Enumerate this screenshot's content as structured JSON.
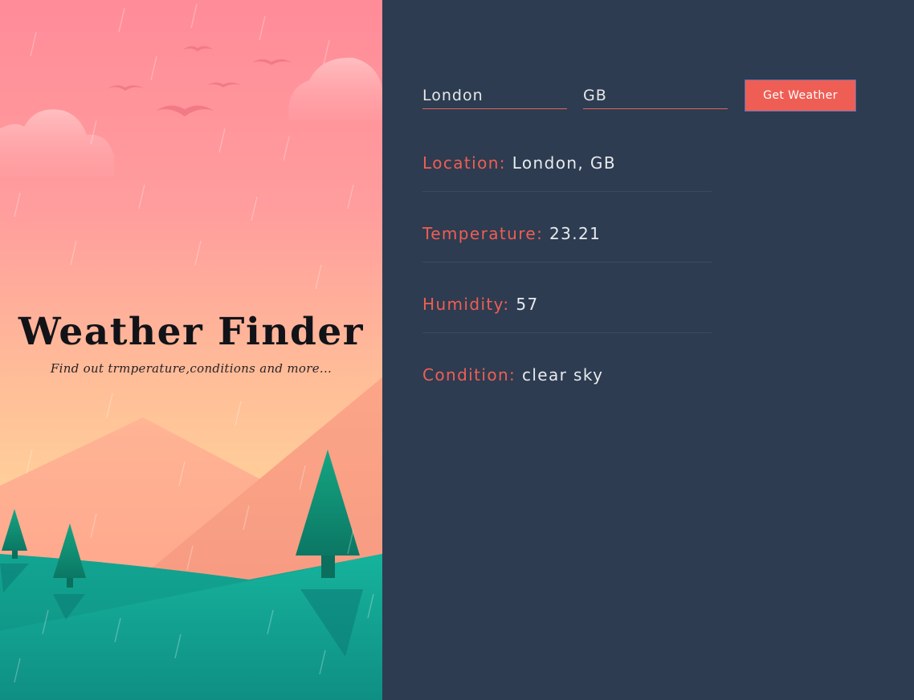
{
  "app": {
    "title": "Weather Finder",
    "subtitle": "Find out trmperature,conditions and more..."
  },
  "form": {
    "city_value": "London",
    "country_value": "GB",
    "submit_label": "Get Weather"
  },
  "results": [
    {
      "label": "Location:",
      "value": "London, GB"
    },
    {
      "label": "Temperature:",
      "value": "23.21"
    },
    {
      "label": "Humidity:",
      "value": "57"
    },
    {
      "label": "Condition:",
      "value": "clear sky"
    }
  ],
  "colors": {
    "background": "#2d3c50",
    "accent": "#ef5e55",
    "sky_top": "#ff8f9a",
    "sky_bottom": "#ffd59a",
    "hills": "#13a896",
    "trees": "#0f8e73"
  }
}
